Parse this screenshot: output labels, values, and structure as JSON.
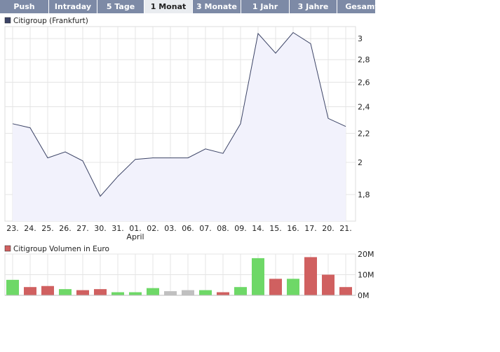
{
  "tabs": [
    {
      "label": "Push",
      "active": false
    },
    {
      "label": "Intraday",
      "active": false
    },
    {
      "label": "5 Tage",
      "active": false
    },
    {
      "label": "1 Monat",
      "active": true
    },
    {
      "label": "3 Monate",
      "active": false
    },
    {
      "label": "1 Jahr",
      "active": false
    },
    {
      "label": "3 Jahre",
      "active": false
    },
    {
      "label": "Gesamt",
      "active": false
    }
  ],
  "chart_data": [
    {
      "type": "area",
      "legend": "Citigroup (Frankfurt)",
      "legend_position": "top-left",
      "color": "#3c4466",
      "fill": "#f2f2fc",
      "categories": [
        "23.",
        "24.",
        "25.",
        "26.",
        "27.",
        "30.",
        "31.",
        "01.",
        "02.",
        "03.",
        "06.",
        "07.",
        "08.",
        "09.",
        "14.",
        "15.",
        "16.",
        "17.",
        "20.",
        "21."
      ],
      "month_label": "April",
      "values": [
        2.27,
        2.24,
        2.03,
        2.07,
        2.01,
        1.79,
        1.91,
        2.02,
        2.03,
        2.03,
        2.03,
        2.09,
        2.06,
        2.27,
        3.05,
        2.86,
        3.06,
        2.95,
        2.31,
        2.25
      ],
      "y_ticks": [
        "1,8",
        "2",
        "2,2",
        "2,4",
        "2,6",
        "2,8",
        "3"
      ],
      "ylim": [
        1.65,
        3.12
      ],
      "y_scale": "log",
      "grid": true
    },
    {
      "type": "bar",
      "legend": "Citigroup Volumen in Euro",
      "legend_color": "#d06060",
      "categories": [
        "23.",
        "24.",
        "25.",
        "26.",
        "27.",
        "30.",
        "31.",
        "01.",
        "02.",
        "03.",
        "06.",
        "07.",
        "08.",
        "09.",
        "14.",
        "15.",
        "16.",
        "17.",
        "20.",
        "21."
      ],
      "values": [
        7.5,
        4,
        4.5,
        3,
        2.5,
        3,
        1.5,
        1.5,
        3.5,
        2,
        2.5,
        2.5,
        1.5,
        4,
        18,
        8,
        8,
        18.5,
        10,
        4
      ],
      "direction": [
        "up",
        "down",
        "down",
        "up",
        "down",
        "down",
        "up",
        "up",
        "up",
        "neutral",
        "neutral",
        "up",
        "down",
        "up",
        "up",
        "down",
        "up",
        "down",
        "down",
        "down"
      ],
      "y_ticks": [
        "0M",
        "10M",
        "20M"
      ],
      "ylim": [
        0,
        20
      ],
      "colors": {
        "up": "#6ed867",
        "down": "#d06060",
        "neutral": "#c0c0c0"
      },
      "grid": true
    }
  ]
}
